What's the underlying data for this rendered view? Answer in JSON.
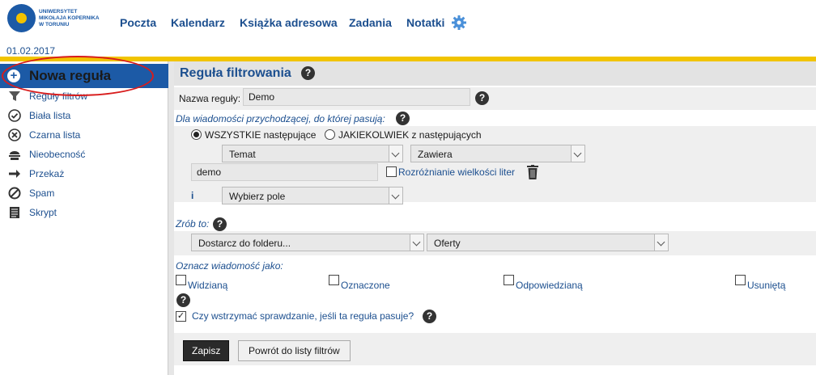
{
  "header": {
    "logo_lines": [
      "UNIWERSYTET",
      "MIKOŁAJA KOPERNIKA",
      "W TORUNIU"
    ],
    "nav": [
      "Poczta",
      "Kalendarz",
      "Książka adresowa",
      "Zadania",
      "Notatki"
    ],
    "date": "01.02.2017"
  },
  "sidebar": {
    "new_rule": "Nowa reguła",
    "items": [
      "Reguły filtrów",
      "Biała lista",
      "Czarna lista",
      "Nieobecność",
      "Przekaż",
      "Spam",
      "Skrypt"
    ]
  },
  "main": {
    "title": "Reguła filtrowania",
    "rule_name_label": "Nazwa reguły:",
    "rule_name_value": "Demo",
    "for_messages_label": "Dla wiadomości przychodzącej, do której pasują:",
    "radio_all": "WSZYSTKIE następujące",
    "radio_any": "JAKIEKOLWIEK z następujących",
    "field_select": "Temat",
    "op_select": "Zawiera",
    "match_value": "demo",
    "case_label": "Rozróżnianie wielkości liter",
    "and_label": "i",
    "choose_field": "Wybierz pole",
    "do_label": "Zrób to:",
    "action_select": "Dostarcz do folderu...",
    "folder_select": "Oferty",
    "mark_label": "Oznacz wiadomość jako:",
    "marks": [
      "Widzianą",
      "Oznaczone",
      "Odpowiedzianą",
      "Usuniętą"
    ],
    "stop_label": "Czy wstrzymać sprawdzanie, jeśli ta reguła pasuje?",
    "save": "Zapisz",
    "back": "Powrót do listy filtrów"
  },
  "colors": {
    "brand": "#1c5aa6",
    "accent": "#f1c400",
    "highlight_oval": "#d81c1c"
  }
}
